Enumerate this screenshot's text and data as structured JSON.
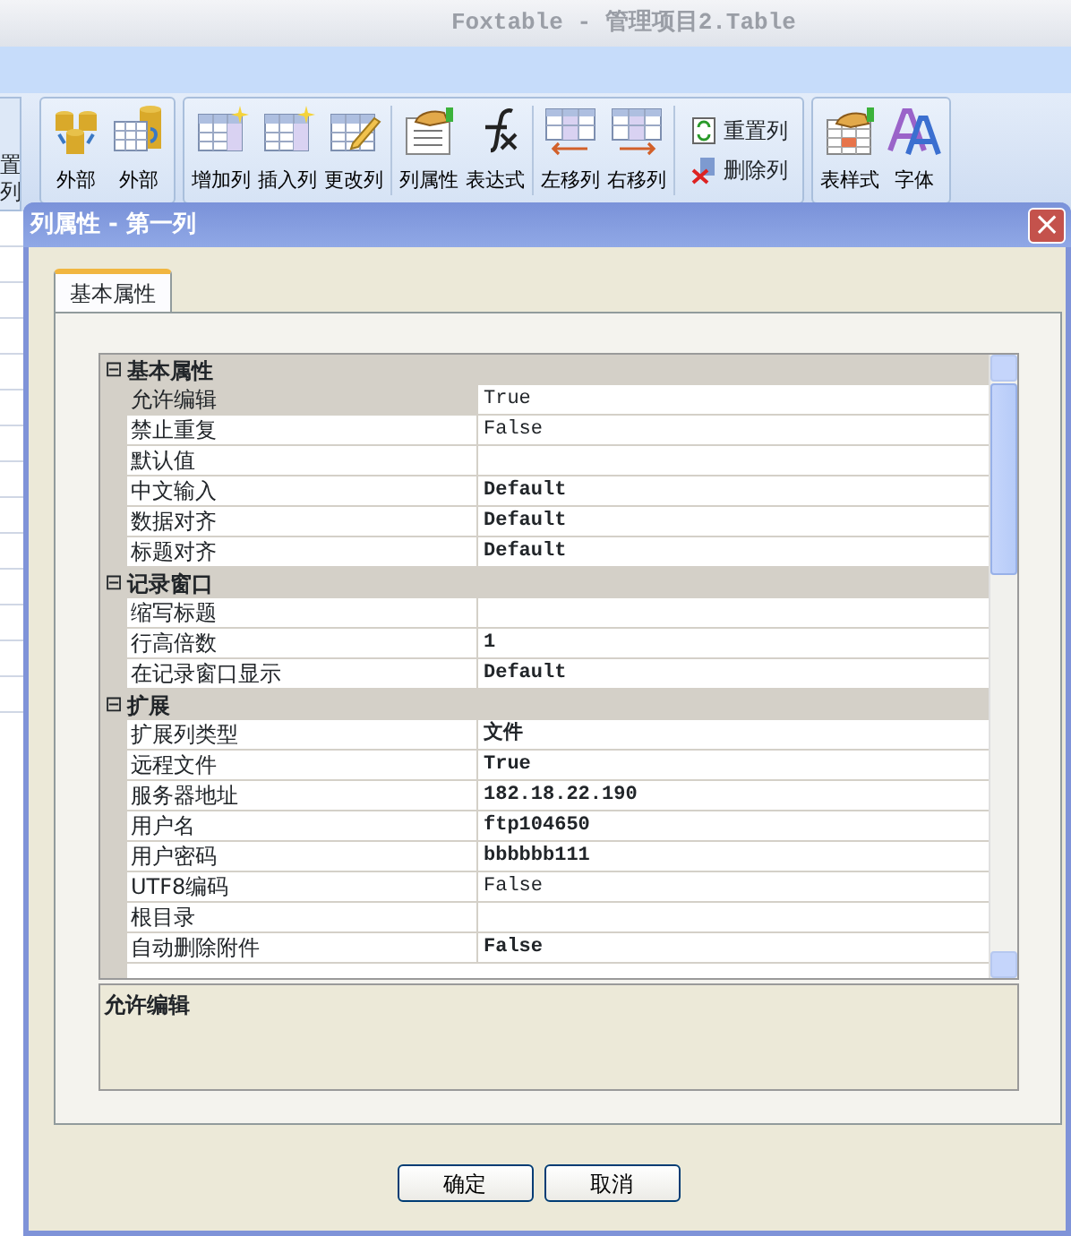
{
  "window": {
    "title": "Foxtable - 管理项目2.Table"
  },
  "toolbar": {
    "cut_group": [
      "置",
      "列"
    ],
    "groups": [
      [
        {
          "label": "外部",
          "kind": "large"
        },
        {
          "label": "外部",
          "kind": "large"
        }
      ],
      [
        {
          "label": "增加列",
          "kind": "large"
        },
        {
          "label": "插入列",
          "kind": "large"
        },
        {
          "label": "更改列",
          "kind": "large"
        },
        {
          "label": "列属性",
          "kind": "large"
        },
        {
          "label": "表达式",
          "kind": "large"
        },
        {
          "label": "左移列",
          "kind": "large"
        },
        {
          "label": "右移列",
          "kind": "large"
        },
        {
          "label": "重置列",
          "kind": "small"
        },
        {
          "label": "删除列",
          "kind": "small"
        }
      ],
      [
        {
          "label": "表样式",
          "kind": "large"
        },
        {
          "label": "字体",
          "kind": "large"
        }
      ]
    ]
  },
  "dialog": {
    "title": "列属性 - 第一列",
    "close": "×",
    "tabs": [
      {
        "label": "基本属性",
        "selected": true
      }
    ],
    "categories": [
      {
        "toggle": "⊟",
        "name": "基本属性",
        "rows": [
          {
            "name": "允许编辑",
            "value": "True",
            "bold": false,
            "selected": true
          },
          {
            "name": "禁止重复",
            "value": "False",
            "bold": false,
            "selected": false
          },
          {
            "name": "默认值",
            "value": "",
            "selected": false
          },
          {
            "name": "中文输入",
            "value": "Default",
            "bold": true,
            "selected": false
          },
          {
            "name": "数据对齐",
            "value": "Default",
            "bold": true,
            "selected": false
          },
          {
            "name": "标题对齐",
            "value": "Default",
            "bold": true,
            "selected": false
          }
        ]
      },
      {
        "toggle": "⊟",
        "name": "记录窗口",
        "rows": [
          {
            "name": "缩写标题",
            "value": "",
            "selected": false
          },
          {
            "name": "行高倍数",
            "value": "1",
            "bold": true,
            "selected": false
          },
          {
            "name": "在记录窗口显示",
            "value": "Default",
            "bold": true,
            "selected": false
          }
        ]
      },
      {
        "toggle": "⊟",
        "name": "扩展",
        "rows": [
          {
            "name": "扩展列类型",
            "value": "文件",
            "bold": true,
            "selected": false
          },
          {
            "name": "远程文件",
            "value": "True",
            "bold": true,
            "selected": false
          },
          {
            "name": "服务器地址",
            "value": "182.18.22.190",
            "bold": true,
            "selected": false
          },
          {
            "name": "用户名",
            "value": "ftp104650",
            "bold": true,
            "selected": false
          },
          {
            "name": "用户密码",
            "value": "bbbbbb111",
            "bold": true,
            "selected": false
          },
          {
            "name": "UTF8编码",
            "value": "False",
            "bold": false,
            "selected": false
          },
          {
            "name": "根目录",
            "value": "",
            "selected": false
          },
          {
            "name": "自动删除附件",
            "value": "False",
            "bold": true,
            "selected": false
          }
        ]
      }
    ],
    "description": "允许编辑",
    "buttons": [
      "确定",
      "取消"
    ]
  }
}
